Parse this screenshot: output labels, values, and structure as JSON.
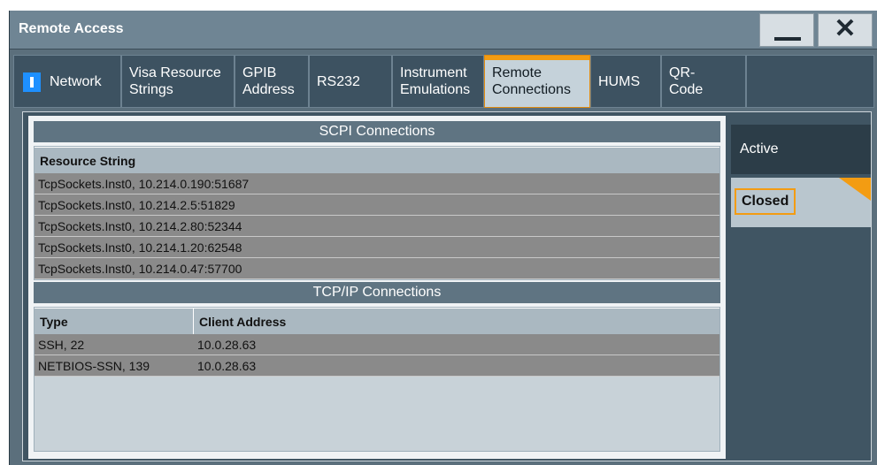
{
  "window": {
    "title": "Remote Access",
    "minimize_icon": "minimize-icon",
    "close_icon": "close-icon",
    "close_glyph": "✕"
  },
  "tabs": [
    {
      "line1": "Network",
      "line2": ""
    },
    {
      "line1": "Visa Resource",
      "line2": "Strings"
    },
    {
      "line1": "GPIB",
      "line2": "Address"
    },
    {
      "line1": "RS232",
      "line2": ""
    },
    {
      "line1": "Instrument",
      "line2": "Emulations"
    },
    {
      "line1": "Remote",
      "line2": "Connections"
    },
    {
      "line1": "HUMS",
      "line2": ""
    },
    {
      "line1": "QR-",
      "line2": "Code"
    }
  ],
  "active_tab_index": 5,
  "scpi": {
    "heading": "SCPI Connections",
    "column": "Resource String",
    "rows": [
      "TcpSockets.Inst0, 10.214.0.190:51687",
      "TcpSockets.Inst0, 10.214.2.5:51829",
      "TcpSockets.Inst0, 10.214.2.80:52344",
      "TcpSockets.Inst0, 10.214.1.20:62548",
      "TcpSockets.Inst0, 10.214.0.47:57700"
    ]
  },
  "tcpip": {
    "heading": "TCP/IP Connections",
    "columns": [
      "Type",
      "Client Address"
    ],
    "rows": [
      {
        "type": "SSH, 22",
        "address": "10.0.28.63"
      },
      {
        "type": "NETBIOS-SSN, 139",
        "address": "10.0.28.63"
      }
    ]
  },
  "side": {
    "active_label": "Active",
    "closed_label": "Closed"
  },
  "colors": {
    "accent": "#f39c12",
    "network_marker": "#1e90ff"
  }
}
